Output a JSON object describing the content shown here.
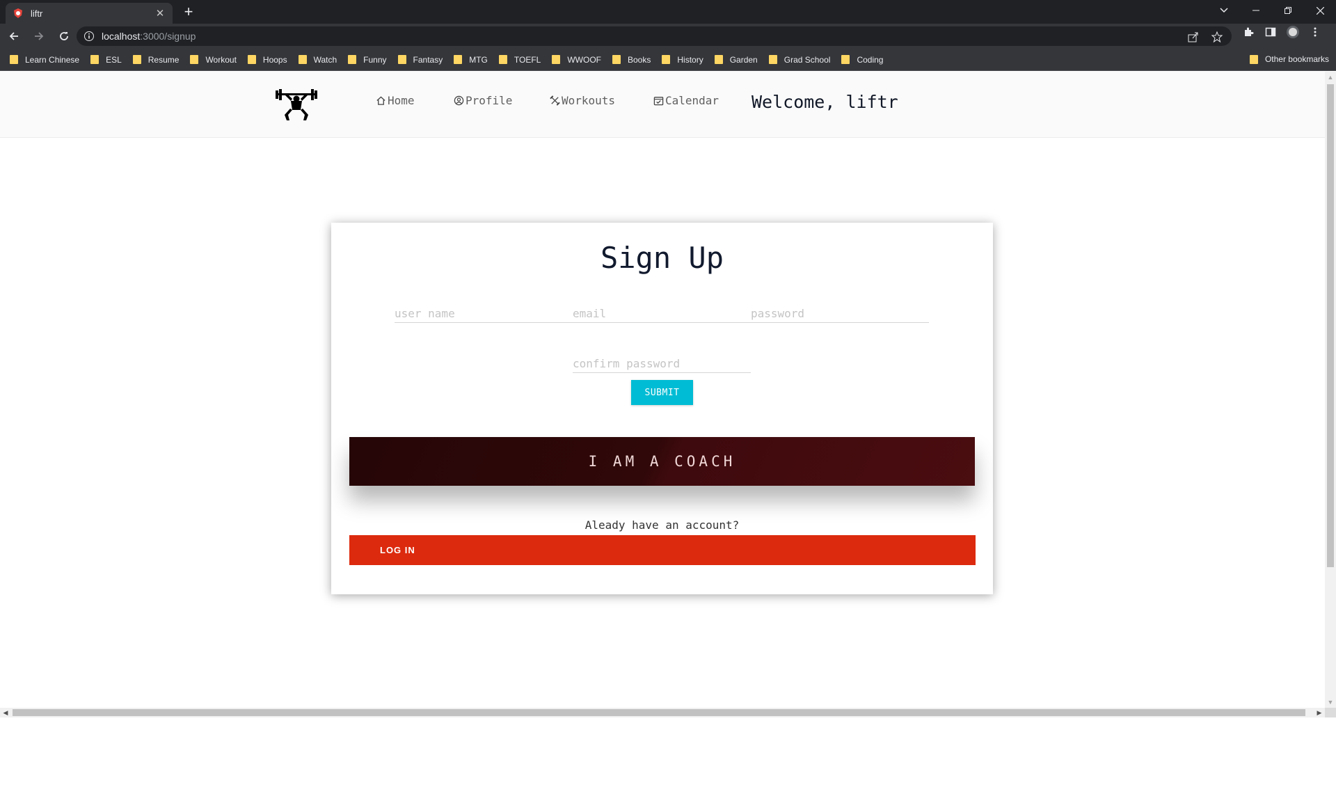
{
  "browser": {
    "tab_title": "liftr",
    "tab_close_icon": "close-icon",
    "new_tab_icon": "plus-icon",
    "url_host": "localhost",
    "url_path": ":3000/signup",
    "bookmarks": [
      "Learn Chinese",
      "ESL",
      "Resume",
      "Workout",
      "Hoops",
      "Watch",
      "Funny",
      "Fantasy",
      "MTG",
      "TOEFL",
      "WWOOF",
      "Books",
      "History",
      "Garden",
      "Grad School",
      "Coding"
    ],
    "other_bookmarks": "Other bookmarks",
    "folder_color": "#fdd663"
  },
  "nav": {
    "home": "Home",
    "profile": "Profile",
    "workouts": "Workouts",
    "calendar": "Calendar",
    "welcome": "Welcome, liftr"
  },
  "signup": {
    "title": "Sign Up",
    "username_placeholder": "user name",
    "email_placeholder": "email",
    "password_placeholder": "password",
    "confirm_placeholder": "confirm password",
    "submit_label": "SUBMIT",
    "coach_label": "I AM A COACH",
    "already_text": "Aleady have an account?",
    "login_label": "LOG IN"
  },
  "colors": {
    "submit": "#00bcd4",
    "coach": "#300809",
    "login": "#dc2a0e"
  }
}
